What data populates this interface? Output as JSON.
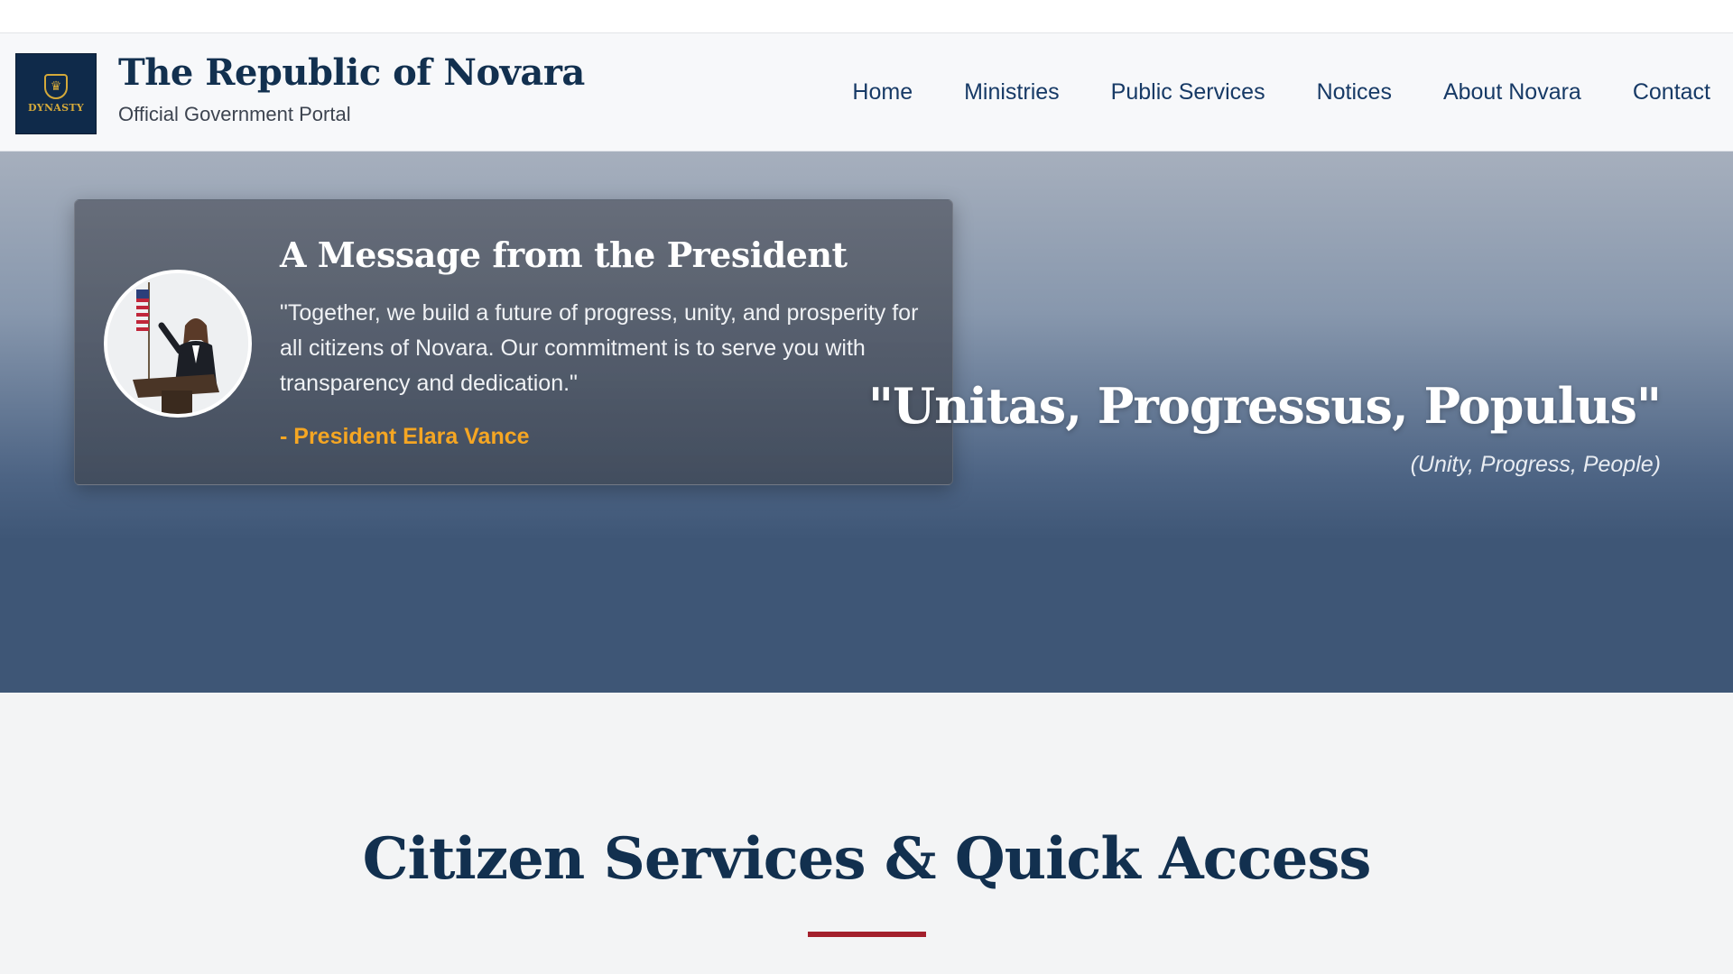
{
  "header": {
    "logo_text": "DYNASTY",
    "title": "The Republic of Novara",
    "subtitle": "Official Government Portal"
  },
  "nav": {
    "items": [
      {
        "label": "Home"
      },
      {
        "label": "Ministries"
      },
      {
        "label": "Public Services"
      },
      {
        "label": "Notices"
      },
      {
        "label": "About Novara"
      },
      {
        "label": "Contact"
      }
    ]
  },
  "hero": {
    "card_title": "A Message from the President",
    "quote": "\"Together, we build a future of progress, unity, and prosperity for all citizens of Novara. Our commitment is to serve you with transparency and dedication.\"",
    "signature": "- President Elara Vance",
    "motto": "\"Unitas, Progressus, Populus\"",
    "motto_translation": "(Unity, Progress, People)"
  },
  "services": {
    "title": "Citizen Services & Quick Access"
  },
  "colors": {
    "navy": "#12304f",
    "nav_link": "#173a66",
    "accent_orange": "#f5a623",
    "accent_red": "#a3202c",
    "hero_dark": "#3e5676"
  },
  "icons": {
    "logo": "crest-shield-icon",
    "avatar": "president-portrait"
  }
}
